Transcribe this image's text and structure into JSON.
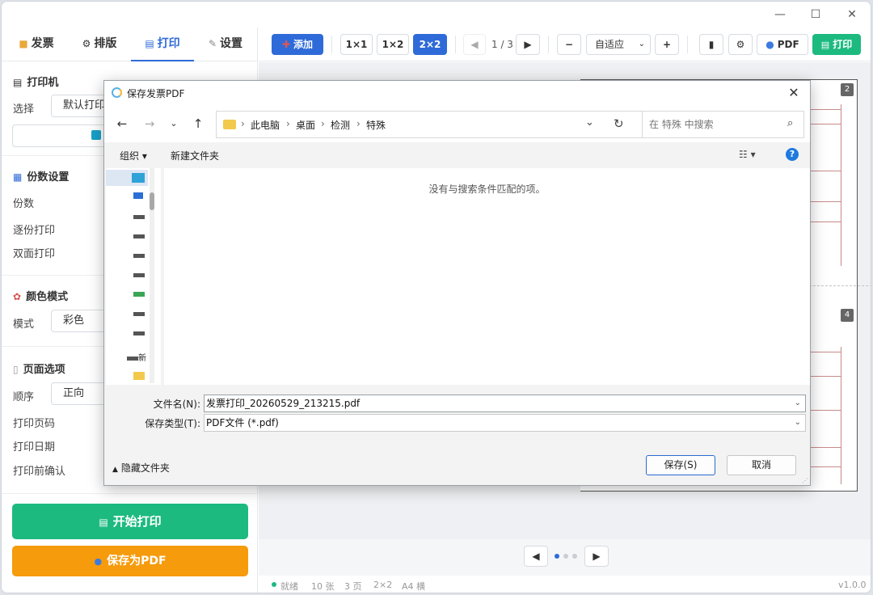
{
  "window": {
    "min_glyph": "—",
    "max_glyph": "☐",
    "close_glyph": "✕"
  },
  "left_panel": {
    "tabs": [
      {
        "label": "发票",
        "icon": "folder-icon"
      },
      {
        "label": "排版",
        "icon": "gear-icon"
      },
      {
        "label": "打印",
        "icon": "printer-icon",
        "active": true
      },
      {
        "label": "设置",
        "icon": "wrench-icon"
      }
    ],
    "printer": {
      "title": "打印机",
      "select_label": "选择",
      "select_value": "默认打印"
    },
    "copies": {
      "title": "份数设置",
      "copies_label": "份数",
      "collate_label": "逐份打印",
      "duplex_label": "双面打印"
    },
    "color": {
      "title": "颜色模式",
      "mode_label": "模式",
      "mode_value": "彩色"
    },
    "page": {
      "title": "页面选项",
      "order_label": "顺序",
      "order_value": "正向",
      "page_number_label": "打印页码",
      "date_label": "打印日期",
      "confirm_label": "打印前确认"
    },
    "start_print": "开始打印",
    "save_pdf": "保存为PDF"
  },
  "toolbar": {
    "add": "添加",
    "layouts": [
      "1×1",
      "1×2",
      "2×2"
    ],
    "active_layout": "2×2",
    "page_indicator": "1 / 3",
    "zoom_value": "自适应",
    "pdf": "PDF",
    "print": "打印"
  },
  "preview": {
    "badges": [
      "2",
      "4"
    ]
  },
  "status": {
    "state": "就绪",
    "count": "10 张",
    "pages": "3 页",
    "layout": "2×2",
    "paper": "A4 横",
    "version": "v1.0.0"
  },
  "dialog": {
    "title": "保存发票PDF",
    "breadcrumb": [
      "此电脑",
      "桌面",
      "检测",
      "特殊"
    ],
    "search_placeholder": "在 特殊 中搜索",
    "organize": "组织 ▾",
    "new_folder": "新建文件夹",
    "empty_message": "没有与搜索条件匹配的项。",
    "filename_label": "文件名(N):",
    "filename_value": "发票打印_20260529_213215.pdf",
    "filetype_label": "保存类型(T):",
    "filetype_value": "PDF文件 (*.pdf)",
    "hide_folders": "隐藏文件夹",
    "save": "保存(S)",
    "cancel": "取消",
    "nav_trailing_label": "新"
  },
  "colors": {
    "primary": "#2f6bd8",
    "green": "#1dba80",
    "orange": "#f59b0c"
  }
}
